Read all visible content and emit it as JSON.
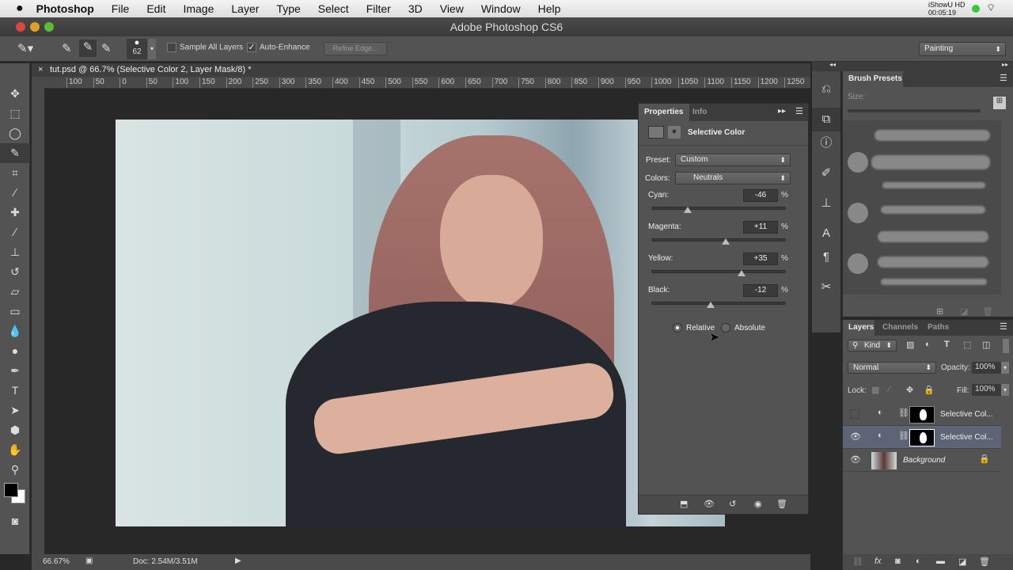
{
  "menubar": {
    "apple": "",
    "app": "Photoshop",
    "items": [
      "File",
      "Edit",
      "Image",
      "Layer",
      "Type",
      "Select",
      "Filter",
      "3D",
      "View",
      "Window",
      "Help"
    ],
    "recorder": "iShowU HD",
    "recorder_time": "00:05:19"
  },
  "titlebar": {
    "title": "Adobe Photoshop CS6"
  },
  "options": {
    "brush_size": "62",
    "sample_all_layers": "Sample All Layers",
    "sample_all_layers_checked": false,
    "auto_enhance": "Auto-Enhance",
    "auto_enhance_checked": true,
    "refine_edge": "Refine Edge...",
    "workspace": "Painting"
  },
  "document": {
    "tab_title": "tut.psd @ 66.7% (Selective Color 2, Layer Mask/8) *",
    "ruler_ticks": [
      "100",
      "50",
      "0",
      "50",
      "100",
      "150",
      "200",
      "250",
      "300",
      "350",
      "400",
      "450",
      "500",
      "550",
      "600",
      "650",
      "700",
      "750",
      "800",
      "850",
      "900",
      "950",
      "1000",
      "1050",
      "1100",
      "1150",
      "1200",
      "1250"
    ]
  },
  "status": {
    "zoom": "66.67%",
    "doc": "Doc: 2.54M/3.51M"
  },
  "properties": {
    "tabs": [
      "Properties",
      "Info"
    ],
    "title": "Selective Color",
    "preset_label": "Preset:",
    "preset": "Custom",
    "colors_label": "Colors:",
    "colors": "Neutrals",
    "sliders": [
      {
        "label": "Cyan:",
        "value": "-46",
        "num": -46
      },
      {
        "label": "Magenta:",
        "value": "+11",
        "num": 11
      },
      {
        "label": "Yellow:",
        "value": "+35",
        "num": 35
      },
      {
        "label": "Black:",
        "value": "-12",
        "num": -12
      }
    ],
    "percent": "%",
    "method": [
      {
        "label": "Relative",
        "checked": true
      },
      {
        "label": "Absolute",
        "checked": false
      }
    ]
  },
  "brush_presets": {
    "title": "Brush Presets",
    "size_label": "Size:"
  },
  "layers": {
    "tabs": [
      "Layers",
      "Channels",
      "Paths"
    ],
    "filter": "Kind",
    "blend_mode": "Normal",
    "opacity_label": "Opacity:",
    "opacity": "100%",
    "lock_label": "Lock:",
    "fill_label": "Fill:",
    "fill": "100%",
    "items": [
      {
        "name": "Selective Col...",
        "visible": false,
        "selected": false
      },
      {
        "name": "Selective Col...",
        "visible": true,
        "selected": true
      },
      {
        "name": "Background",
        "visible": true,
        "selected": false,
        "locked": true
      }
    ]
  }
}
